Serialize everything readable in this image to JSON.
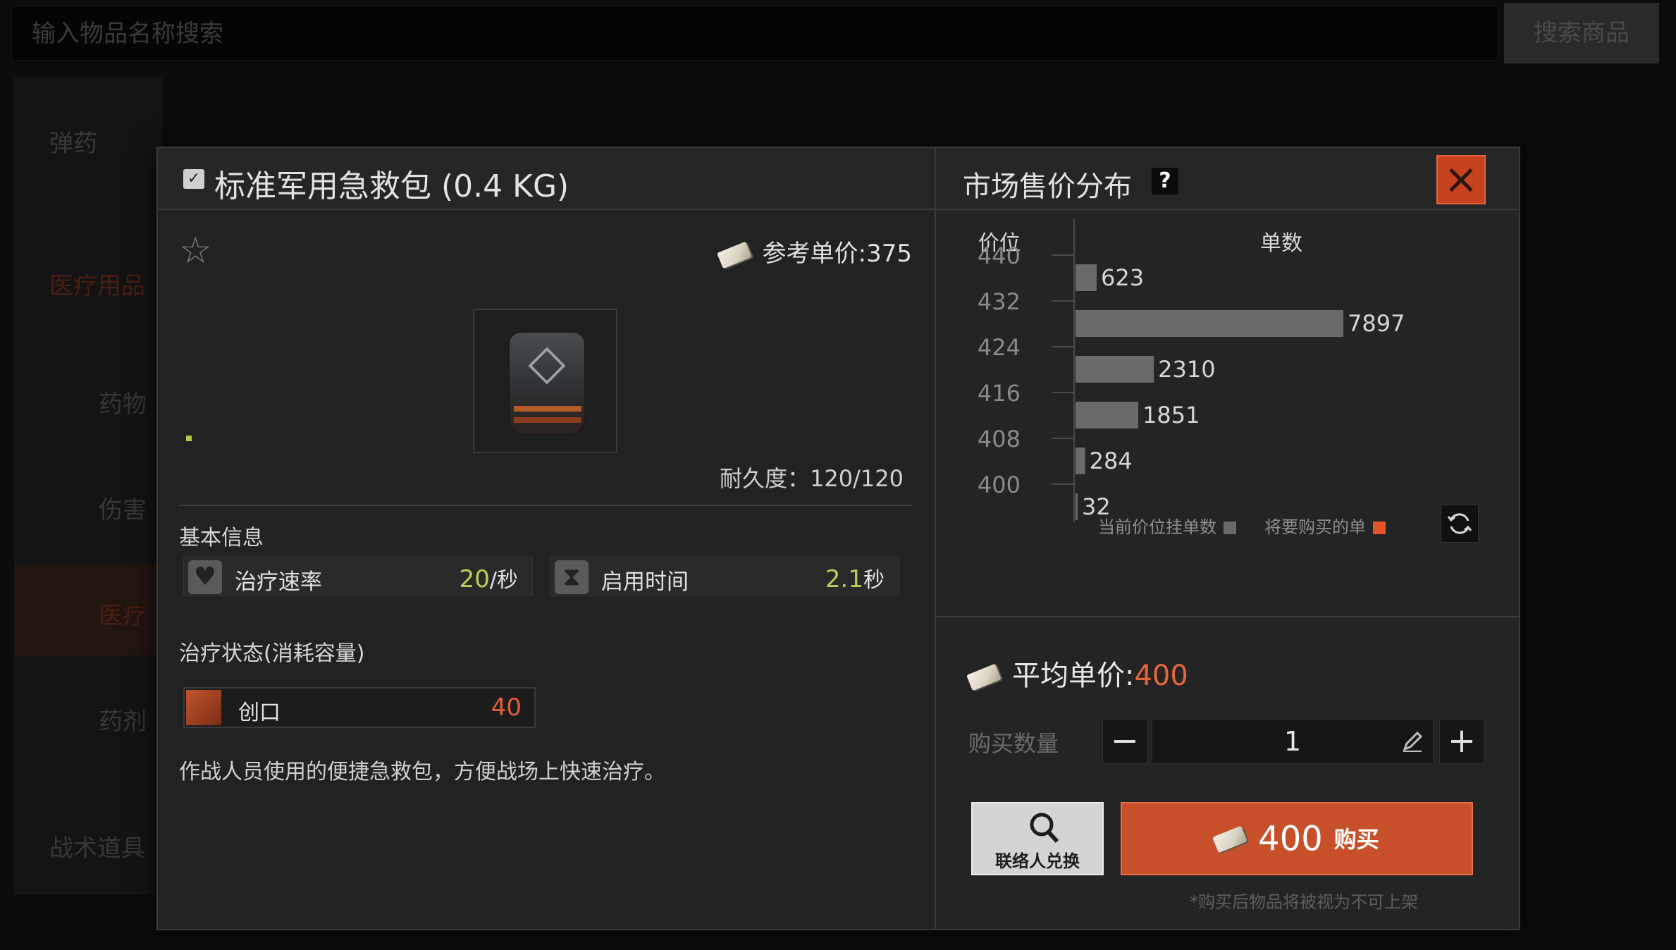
{
  "background": {
    "search_placeholder": "输入物品名称搜索",
    "search_button": "搜索商品",
    "sidebar": [
      {
        "label": "弹药"
      },
      {
        "label": "医疗用品"
      },
      {
        "label": "药物"
      },
      {
        "label": "伤害"
      },
      {
        "label": "医疗"
      },
      {
        "label": "药剂"
      },
      {
        "label": "战术道具"
      }
    ]
  },
  "item": {
    "title": "标准军用急救包 (0.4 KG)",
    "ref_price_label": "参考单价:",
    "ref_price_value": "375",
    "durability_label": "耐久度：",
    "durability_value": "120/120",
    "basic_info_label": "基本信息",
    "stats": [
      {
        "icon": "heart-plus-icon",
        "name": "治疗速率",
        "value": "20",
        "unit": "/秒"
      },
      {
        "icon": "hourglass-icon",
        "name": "启用时间",
        "value": "2.1",
        "unit": "秒"
      }
    ],
    "treatment_label": "治疗状态(消耗容量)",
    "treatments": [
      {
        "icon": "bandage-icon",
        "name": "创口",
        "value": "40"
      }
    ],
    "description": "作战人员使用的便捷急救包，方便战场上快速治疗。"
  },
  "market": {
    "title": "市场售价分布",
    "help": "?",
    "col_price": "价位",
    "col_count": "单数",
    "legend_current": "当前价位挂单数",
    "legend_buy": "将要购买的单",
    "legend_colors": {
      "current": "#6a6a6a",
      "buy": "#e6552a"
    },
    "avg_price_label": "平均单价:",
    "avg_price_value": "400",
    "qty_label": "购买数量",
    "qty_value": "1",
    "contact_label": "联络人兑换",
    "buy_price": "400",
    "buy_label": "购买",
    "note": "*购买后物品将被视为不可上架"
  },
  "chart_data": {
    "type": "bar",
    "orientation": "horizontal",
    "y_ticks": [
      "440",
      "432",
      "424",
      "416",
      "408",
      "400"
    ],
    "counts": [
      623,
      7897,
      2310,
      1851,
      284,
      32
    ],
    "xlabel": "单数",
    "ylabel": "价位",
    "bar_color": "#6a6a6a"
  }
}
